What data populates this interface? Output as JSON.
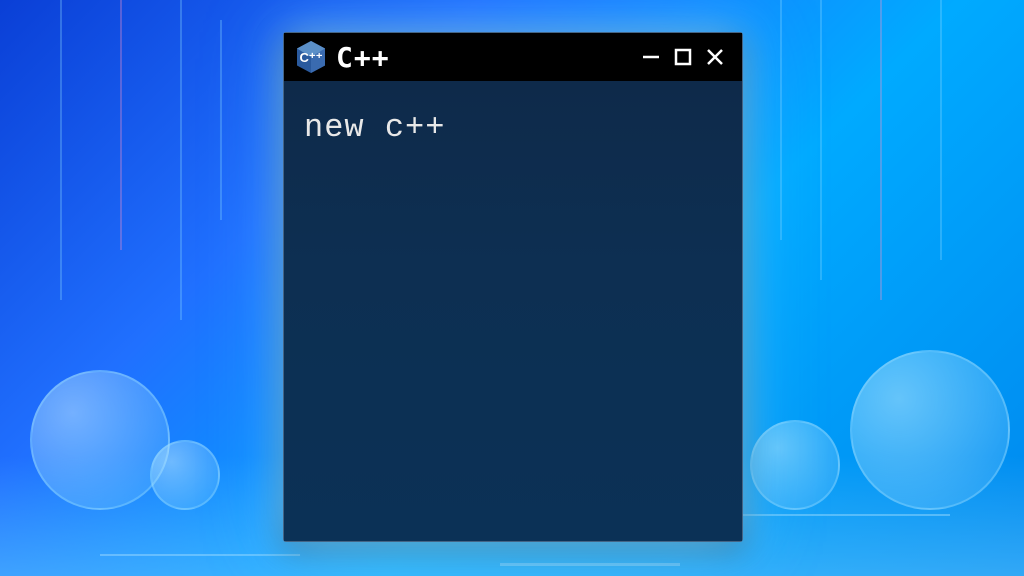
{
  "window": {
    "title": "C++",
    "icon_name": "cpp-hexagon-icon"
  },
  "content": {
    "code": "new c++"
  },
  "controls": {
    "minimize": "−",
    "maximize": "□",
    "close": "✕"
  },
  "colors": {
    "titlebar_bg": "#000000",
    "content_bg": "#0d2f52",
    "text": "#e8e8e8",
    "icon_blue": "#2a5a9e",
    "icon_light": "#5b8fc7",
    "glow": "#96dcff"
  }
}
